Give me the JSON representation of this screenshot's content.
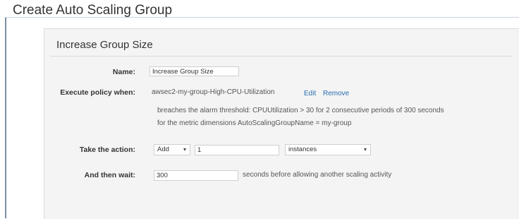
{
  "page": {
    "title": "Create Auto Scaling Group"
  },
  "panel": {
    "title": "Increase Group Size"
  },
  "labels": {
    "name": "Name:",
    "execute": "Execute policy when:",
    "action": "Take the action:",
    "wait": "And then wait:"
  },
  "name_field": {
    "value": "Increase Group Size"
  },
  "policy": {
    "alarm": "awsec2-my-group-High-CPU-Utilization",
    "edit": "Edit",
    "remove": "Remove",
    "line1": "breaches the alarm threshold: CPUUtilization > 30 for 2 consecutive periods of 300 seconds",
    "line2": "for the metric dimensions AutoScalingGroupName = my-group"
  },
  "action": {
    "type": "Add",
    "amount": "1",
    "unit": "instances",
    "caret": "▾"
  },
  "wait": {
    "value": "300",
    "suffix": "seconds before allowing another scaling activity"
  }
}
